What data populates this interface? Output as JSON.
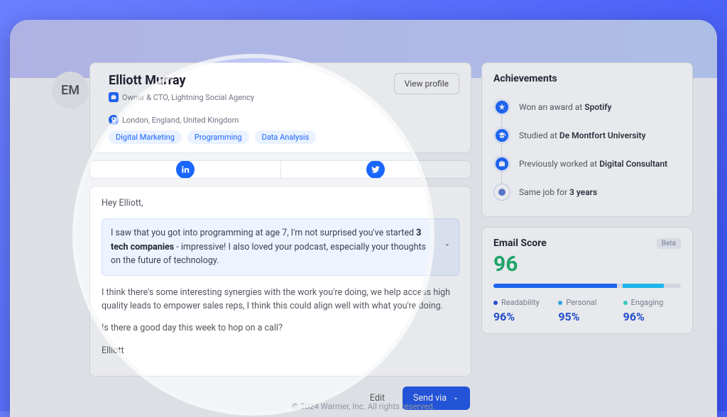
{
  "profile": {
    "initials": "EM",
    "name": "Elliott Murray",
    "title": "Owner & CTO, Lightning Social Agency",
    "location": "London, England, United Kingdom",
    "tags": [
      "Digital Marketing",
      "Programming",
      "Data Analysis"
    ],
    "view_button": "View profile"
  },
  "social": {
    "linkedin": "linkedin-icon",
    "twitter": "twitter-icon"
  },
  "email": {
    "greeting": "Hey Elliott,",
    "highlight_pre": "I saw that you got into programming at age 7, I'm not surprised you've started ",
    "highlight_bold": "3 tech companies",
    "highlight_post": " - impressive! I also loved your podcast, especially your thoughts on the future of technology.",
    "body1": "I think there's some interesting synergies with the work you're doing, we help access high quality leads to empower sales reps, I think this could align well with what you're doing.",
    "body2": "Is there a good day this week to hop on a call?",
    "signoff": "Elliott"
  },
  "actions": {
    "edit": "Edit",
    "send": "Send via"
  },
  "achievements": {
    "title": "Achievements",
    "items": [
      {
        "pre": "Won an award at ",
        "bold": "Spotify",
        "icon": "star"
      },
      {
        "pre": "Studied at ",
        "bold": "De Montfort University",
        "icon": "edu"
      },
      {
        "pre": "Previously worked at ",
        "bold": "Digital Consultant",
        "icon": "work"
      },
      {
        "pre": "Same job for ",
        "bold": "3 years",
        "icon": "clock"
      }
    ]
  },
  "score": {
    "title": "Email Score",
    "badge": "Beta",
    "value": "96",
    "metrics": [
      {
        "label": "Readability",
        "value": "96%"
      },
      {
        "label": "Personal",
        "value": "95%"
      },
      {
        "label": "Engaging",
        "value": "96%"
      }
    ]
  },
  "footer": "© 2024 Warmer, Inc. All rights reserved."
}
